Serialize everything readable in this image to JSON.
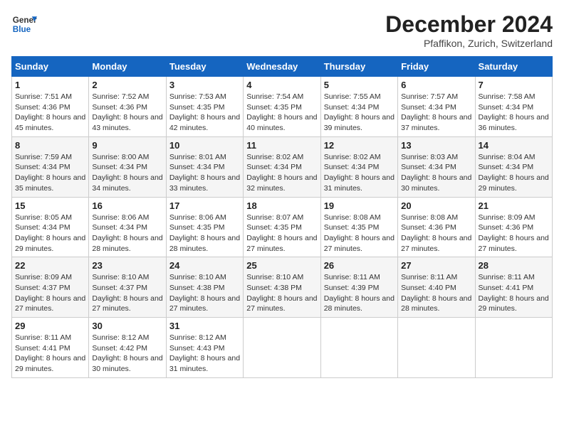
{
  "header": {
    "logo_general": "General",
    "logo_blue": "Blue",
    "month_title": "December 2024",
    "location": "Pfaffikon, Zurich, Switzerland"
  },
  "days_of_week": [
    "Sunday",
    "Monday",
    "Tuesday",
    "Wednesday",
    "Thursday",
    "Friday",
    "Saturday"
  ],
  "weeks": [
    [
      {
        "day": "1",
        "sunrise": "Sunrise: 7:51 AM",
        "sunset": "Sunset: 4:36 PM",
        "daylight": "Daylight: 8 hours and 45 minutes."
      },
      {
        "day": "2",
        "sunrise": "Sunrise: 7:52 AM",
        "sunset": "Sunset: 4:36 PM",
        "daylight": "Daylight: 8 hours and 43 minutes."
      },
      {
        "day": "3",
        "sunrise": "Sunrise: 7:53 AM",
        "sunset": "Sunset: 4:35 PM",
        "daylight": "Daylight: 8 hours and 42 minutes."
      },
      {
        "day": "4",
        "sunrise": "Sunrise: 7:54 AM",
        "sunset": "Sunset: 4:35 PM",
        "daylight": "Daylight: 8 hours and 40 minutes."
      },
      {
        "day": "5",
        "sunrise": "Sunrise: 7:55 AM",
        "sunset": "Sunset: 4:34 PM",
        "daylight": "Daylight: 8 hours and 39 minutes."
      },
      {
        "day": "6",
        "sunrise": "Sunrise: 7:57 AM",
        "sunset": "Sunset: 4:34 PM",
        "daylight": "Daylight: 8 hours and 37 minutes."
      },
      {
        "day": "7",
        "sunrise": "Sunrise: 7:58 AM",
        "sunset": "Sunset: 4:34 PM",
        "daylight": "Daylight: 8 hours and 36 minutes."
      }
    ],
    [
      {
        "day": "8",
        "sunrise": "Sunrise: 7:59 AM",
        "sunset": "Sunset: 4:34 PM",
        "daylight": "Daylight: 8 hours and 35 minutes."
      },
      {
        "day": "9",
        "sunrise": "Sunrise: 8:00 AM",
        "sunset": "Sunset: 4:34 PM",
        "daylight": "Daylight: 8 hours and 34 minutes."
      },
      {
        "day": "10",
        "sunrise": "Sunrise: 8:01 AM",
        "sunset": "Sunset: 4:34 PM",
        "daylight": "Daylight: 8 hours and 33 minutes."
      },
      {
        "day": "11",
        "sunrise": "Sunrise: 8:02 AM",
        "sunset": "Sunset: 4:34 PM",
        "daylight": "Daylight: 8 hours and 32 minutes."
      },
      {
        "day": "12",
        "sunrise": "Sunrise: 8:02 AM",
        "sunset": "Sunset: 4:34 PM",
        "daylight": "Daylight: 8 hours and 31 minutes."
      },
      {
        "day": "13",
        "sunrise": "Sunrise: 8:03 AM",
        "sunset": "Sunset: 4:34 PM",
        "daylight": "Daylight: 8 hours and 30 minutes."
      },
      {
        "day": "14",
        "sunrise": "Sunrise: 8:04 AM",
        "sunset": "Sunset: 4:34 PM",
        "daylight": "Daylight: 8 hours and 29 minutes."
      }
    ],
    [
      {
        "day": "15",
        "sunrise": "Sunrise: 8:05 AM",
        "sunset": "Sunset: 4:34 PM",
        "daylight": "Daylight: 8 hours and 29 minutes."
      },
      {
        "day": "16",
        "sunrise": "Sunrise: 8:06 AM",
        "sunset": "Sunset: 4:34 PM",
        "daylight": "Daylight: 8 hours and 28 minutes."
      },
      {
        "day": "17",
        "sunrise": "Sunrise: 8:06 AM",
        "sunset": "Sunset: 4:35 PM",
        "daylight": "Daylight: 8 hours and 28 minutes."
      },
      {
        "day": "18",
        "sunrise": "Sunrise: 8:07 AM",
        "sunset": "Sunset: 4:35 PM",
        "daylight": "Daylight: 8 hours and 27 minutes."
      },
      {
        "day": "19",
        "sunrise": "Sunrise: 8:08 AM",
        "sunset": "Sunset: 4:35 PM",
        "daylight": "Daylight: 8 hours and 27 minutes."
      },
      {
        "day": "20",
        "sunrise": "Sunrise: 8:08 AM",
        "sunset": "Sunset: 4:36 PM",
        "daylight": "Daylight: 8 hours and 27 minutes."
      },
      {
        "day": "21",
        "sunrise": "Sunrise: 8:09 AM",
        "sunset": "Sunset: 4:36 PM",
        "daylight": "Daylight: 8 hours and 27 minutes."
      }
    ],
    [
      {
        "day": "22",
        "sunrise": "Sunrise: 8:09 AM",
        "sunset": "Sunset: 4:37 PM",
        "daylight": "Daylight: 8 hours and 27 minutes."
      },
      {
        "day": "23",
        "sunrise": "Sunrise: 8:10 AM",
        "sunset": "Sunset: 4:37 PM",
        "daylight": "Daylight: 8 hours and 27 minutes."
      },
      {
        "day": "24",
        "sunrise": "Sunrise: 8:10 AM",
        "sunset": "Sunset: 4:38 PM",
        "daylight": "Daylight: 8 hours and 27 minutes."
      },
      {
        "day": "25",
        "sunrise": "Sunrise: 8:10 AM",
        "sunset": "Sunset: 4:38 PM",
        "daylight": "Daylight: 8 hours and 27 minutes."
      },
      {
        "day": "26",
        "sunrise": "Sunrise: 8:11 AM",
        "sunset": "Sunset: 4:39 PM",
        "daylight": "Daylight: 8 hours and 28 minutes."
      },
      {
        "day": "27",
        "sunrise": "Sunrise: 8:11 AM",
        "sunset": "Sunset: 4:40 PM",
        "daylight": "Daylight: 8 hours and 28 minutes."
      },
      {
        "day": "28",
        "sunrise": "Sunrise: 8:11 AM",
        "sunset": "Sunset: 4:41 PM",
        "daylight": "Daylight: 8 hours and 29 minutes."
      }
    ],
    [
      {
        "day": "29",
        "sunrise": "Sunrise: 8:11 AM",
        "sunset": "Sunset: 4:41 PM",
        "daylight": "Daylight: 8 hours and 29 minutes."
      },
      {
        "day": "30",
        "sunrise": "Sunrise: 8:12 AM",
        "sunset": "Sunset: 4:42 PM",
        "daylight": "Daylight: 8 hours and 30 minutes."
      },
      {
        "day": "31",
        "sunrise": "Sunrise: 8:12 AM",
        "sunset": "Sunset: 4:43 PM",
        "daylight": "Daylight: 8 hours and 31 minutes."
      },
      null,
      null,
      null,
      null
    ]
  ]
}
